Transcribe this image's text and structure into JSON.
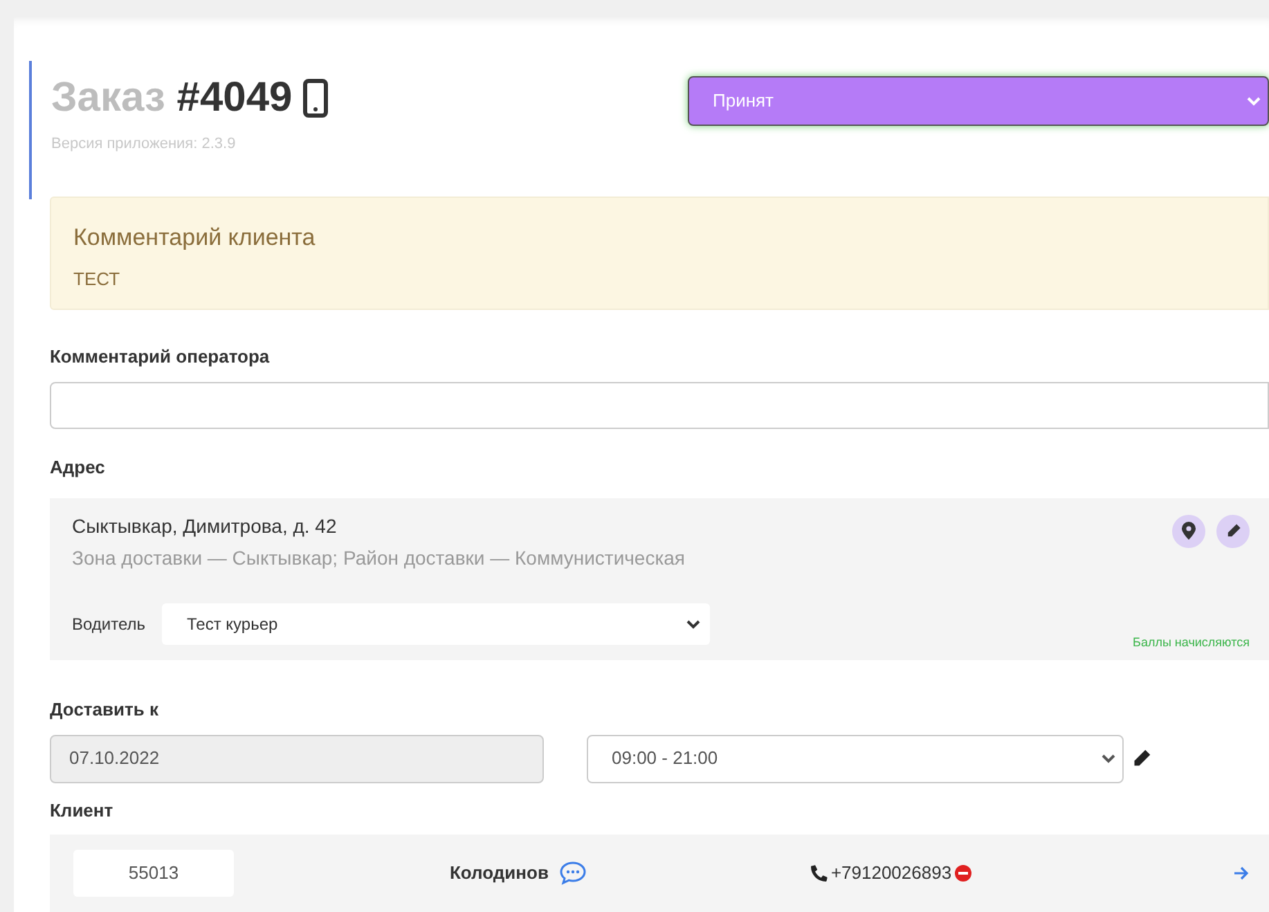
{
  "order": {
    "title_word": "Заказ",
    "number": "#4049",
    "app_version": "Версия приложения: 2.3.9"
  },
  "status_select": {
    "value": "Принят",
    "color": "#b57bf7"
  },
  "client_comment": {
    "title": "Комментарий клиента",
    "text": "ТЕСТ"
  },
  "operator_comment": {
    "label": "Комментарий оператора"
  },
  "address": {
    "label": "Адрес",
    "line": "Сыктывкар, Димитрова, д. 42",
    "zone": "Зона доставки — Сыктывкар; Район доставки — Коммунистическая",
    "driver_label": "Водитель",
    "driver": "Тест курьер",
    "points_note": "Баллы начисляются"
  },
  "deliver": {
    "label": "Доставить к",
    "date": "07.10.2022",
    "time": "09:00 - 21:00"
  },
  "client": {
    "label": "Клиент",
    "id": "55013",
    "name": "Колодинов",
    "phone": "+79120026893",
    "phone_blocked": true
  }
}
